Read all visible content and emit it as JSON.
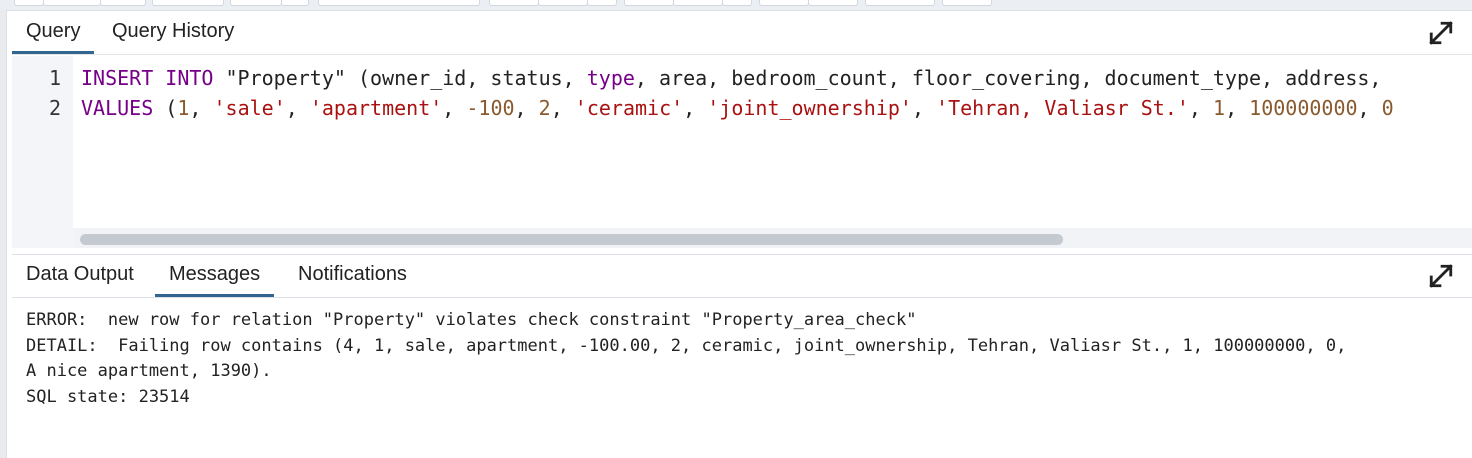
{
  "query_panel": {
    "tabs": [
      {
        "label": "Query",
        "active": true
      },
      {
        "label": "Query History",
        "active": false
      }
    ],
    "expand_icon": "expand-diagonal-icon"
  },
  "editor": {
    "line_numbers": [
      "1",
      "2"
    ],
    "line1": {
      "t0": "INSERT",
      "t1": " ",
      "t2": "INTO",
      "t3": " \"Property\" (owner_id, status, ",
      "t4": "type",
      "t5": ", area, bedroom_count, floor_covering, document_type, address,"
    },
    "line2": {
      "t0": "VALUES",
      "t1": " (",
      "t2": "1",
      "t3": ", ",
      "t4": "'sale'",
      "t5": ", ",
      "t6": "'apartment'",
      "t7": ", ",
      "t8": "-100",
      "t9": ", ",
      "t10": "2",
      "t11": ", ",
      "t12": "'ceramic'",
      "t13": ", ",
      "t14": "'joint_ownership'",
      "t15": ", ",
      "t16": "'Tehran, Valiasr St.'",
      "t17": ", ",
      "t18": "1",
      "t19": ", ",
      "t20": "100000000",
      "t21": ", ",
      "t22": "0"
    }
  },
  "results_panel": {
    "tabs": [
      {
        "label": "Data Output",
        "active": false
      },
      {
        "label": "Messages",
        "active": true
      },
      {
        "label": "Notifications",
        "active": false
      }
    ],
    "expand_icon": "expand-diagonal-icon"
  },
  "messages": {
    "line1": "ERROR:  new row for relation \"Property\" violates check constraint \"Property_area_check\"",
    "line2": "DETAIL:  Failing row contains (4, 1, sale, apartment, -100.00, 2, ceramic, joint_ownership, Tehran, Valiasr St., 1, 100000000, 0,",
    "line3": "A nice apartment, 1390).",
    "line4": "SQL state: 23514"
  },
  "colors": {
    "keyword": "#770088",
    "string": "#aa1111",
    "number": "#8a5a2e",
    "active_tab_underline": "#326690"
  }
}
